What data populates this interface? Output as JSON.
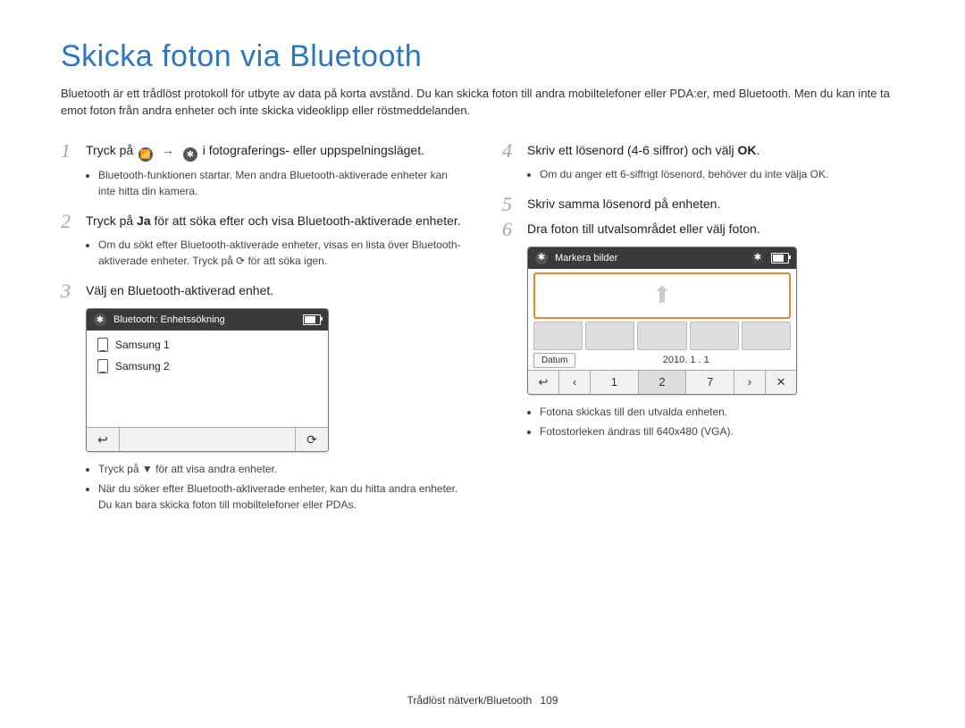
{
  "title": "Skicka foton via Bluetooth",
  "intro": "Bluetooth är ett trådlöst protokoll för utbyte av data på korta avstånd. Du kan skicka foton till andra mobiltelefoner eller PDA:er, med Bluetooth. Men du kan inte ta emot foton från andra enheter och inte skicka videoklipp eller röstmeddelanden.",
  "left": {
    "step1": {
      "num": "1",
      "pre": "Tryck på",
      "post": " i fotograferings- eller uppspelningsläget."
    },
    "step1_bullets": [
      "Bluetooth-funktionen startar. Men andra Bluetooth-aktiverade enheter kan inte hitta din kamera."
    ],
    "step2": {
      "num": "2",
      "pre": "Tryck på ",
      "bold": "Ja",
      "post": " för att söka efter och visa Bluetooth-aktiverade enheter."
    },
    "step2_bullets": [
      "Om du sökt efter Bluetooth-aktiverade enheter, visas en lista över Bluetooth-aktiverade enheter. Tryck på ⟳ för att söka igen."
    ],
    "step3": {
      "num": "3",
      "text": "Välj en Bluetooth-aktiverad enhet."
    },
    "ui1": {
      "header": "Bluetooth: Enhetssökning",
      "items": [
        "Samsung 1",
        "Samsung 2"
      ]
    },
    "step3_bullets": [
      "Tryck på ▼ för att visa andra enheter.",
      "När du söker efter Bluetooth-aktiverade enheter, kan du hitta andra enheter. Du kan bara skicka foton till mobiltelefoner eller PDAs."
    ]
  },
  "right": {
    "step4": {
      "num": "4",
      "pre": "Skriv ett lösenord (4-6 siffror) och välj ",
      "bold": "OK",
      "post": "."
    },
    "step4_bullets": [
      "Om du anger ett 6-siffrigt lösenord, behöver du inte välja OK."
    ],
    "step4_bullet_bold": "OK",
    "step5": {
      "num": "5",
      "text": "Skriv samma lösenord på enheten."
    },
    "step6": {
      "num": "6",
      "text": "Dra foton till utvalsområdet eller välj foton."
    },
    "ui2": {
      "header": "Markera bilder",
      "chip": "Datum",
      "date": "2010. 1 . 1",
      "pages": [
        "1",
        "2",
        "7"
      ]
    },
    "post_bullets": [
      "Fotona skickas till den utvalda enheten.",
      "Fotostorleken ändras till 640x480 (VGA)."
    ]
  },
  "footer": {
    "section": "Trådlöst nätverk/Bluetooth",
    "page": "109"
  }
}
